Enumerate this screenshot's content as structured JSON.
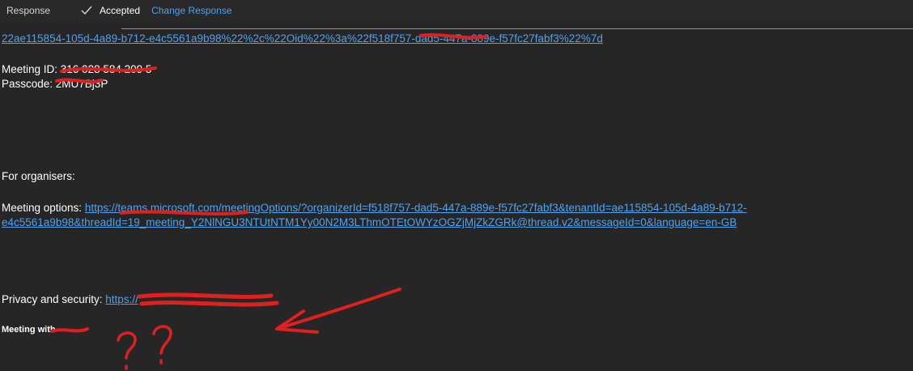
{
  "toolbar": {
    "response_label": "Response",
    "check_icon": "checkmark-icon",
    "status": "Accepted",
    "change_label": "Change Response"
  },
  "join_link_tail": "22ae115854-105d-4a89-b712-e4c5561a9b98%22%2c%22Oid%22%3a%22f518f757-dad5-447a-889e-f57fc27fabf3%22%7d",
  "meeting_id": {
    "label": "Meeting ID: ",
    "value": "316 028 584 209 5"
  },
  "passcode": {
    "label": "Passcode: ",
    "value": "2MU7Bj3P"
  },
  "organisers_heading": "For organisers:",
  "meeting_options": {
    "label": "Meeting options: ",
    "link_line1": "https://teams.microsoft.com/meetingOptions/?organizerId=f518f757-dad5-447a-889e-f57fc27fabf3&tenantId=ae115854-105d-4a89-b712-",
    "link_line2": "e4c5561a9b98&threadId=19_meeting_Y2NlNGU3NTUtNTM1Yy00N2M3LThmOTEtOWYzOGZjMjZkZGRk@thread.v2&messageId=0&language=en-GB"
  },
  "privacy": {
    "label": "Privacy and security: ",
    "link": "https://"
  },
  "footer": "Meeting with",
  "annotation": {
    "color": "#e0201e",
    "marks": "??"
  }
}
